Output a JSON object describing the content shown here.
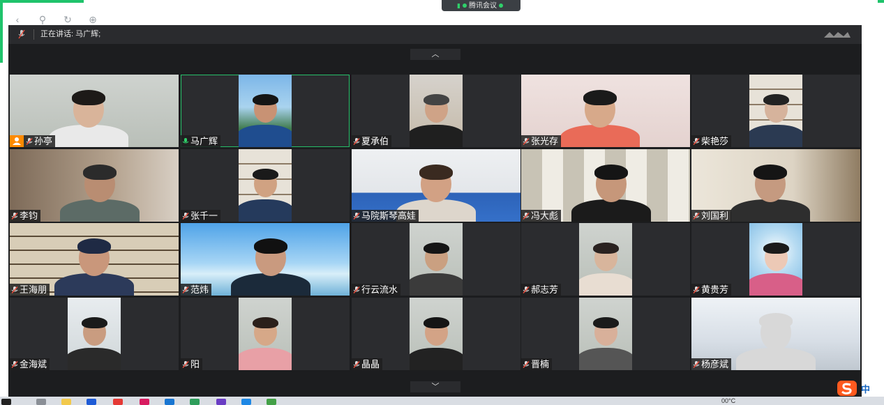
{
  "meeting_pill": {
    "label": "腾讯会议"
  },
  "title_bar": {
    "speaking_label": "正在讲话: 马广辉;"
  },
  "pager": {
    "up": "︿",
    "down": "﹀"
  },
  "participants": [
    {
      "name": "孙亭",
      "host": true,
      "active": false,
      "scene": "wall-light",
      "skin": "#d9b49a",
      "hair": "#1d1a18",
      "shirt": "#e9e9e9"
    },
    {
      "name": "马广辉",
      "host": false,
      "active": true,
      "scene": "mountain",
      "skin": "#c89274",
      "hair": "#151515",
      "shirt": "#1f4d8f"
    },
    {
      "name": "夏承伯",
      "host": false,
      "active": false,
      "scene": "office",
      "skin": "#cfa387",
      "hair": "#444",
      "shirt": "#1f1f1f"
    },
    {
      "name": "张光存",
      "host": false,
      "active": false,
      "scene": "pink-wall",
      "skin": "#d7a98a",
      "hair": "#1a1a1a",
      "shirt": "#e96b58"
    },
    {
      "name": "柴艳莎",
      "host": false,
      "active": false,
      "scene": "shelf",
      "skin": "#d6b39c",
      "hair": "#222",
      "shirt": "#2b3a52"
    },
    {
      "name": "李钧",
      "host": false,
      "active": false,
      "scene": "room-brown",
      "skin": "#b98d72",
      "hair": "#2b2b2b",
      "shirt": "#5c6b66"
    },
    {
      "name": "张千一",
      "host": false,
      "active": false,
      "scene": "shelf",
      "skin": "#d0a282",
      "hair": "#1a1a1a",
      "shirt": "#253a5c"
    },
    {
      "name": "马院斯琴高娃",
      "host": false,
      "active": false,
      "scene": "blue-room",
      "skin": "#d2a184",
      "hair": "#3a2a20",
      "shirt": "#ddd6cc"
    },
    {
      "name": "冯大彪",
      "host": false,
      "active": false,
      "scene": "bookcase",
      "skin": "#c6977a",
      "hair": "#151515",
      "shirt": "#1b1b1b"
    },
    {
      "name": "刘国利",
      "host": false,
      "active": false,
      "scene": "cabinet",
      "skin": "#c59a80",
      "hair": "#151515",
      "shirt": "#2e2e2e"
    },
    {
      "name": "王海朋",
      "host": false,
      "active": false,
      "scene": "bookshelf",
      "skin": "#c9977b",
      "hair": "#1f2a44",
      "shirt": "#2c3a5a"
    },
    {
      "name": "范炜",
      "host": false,
      "active": false,
      "scene": "sky",
      "skin": "#c99a7f",
      "hair": "#111",
      "shirt": "#1b2a3a"
    },
    {
      "name": "行云流水",
      "host": false,
      "active": false,
      "scene": "wall-light",
      "skin": "#caa081",
      "hair": "#151515",
      "shirt": "#3b3b3b"
    },
    {
      "name": "郝志芳",
      "host": false,
      "active": false,
      "scene": "wall-light",
      "skin": "#d8b59c",
      "hair": "#2a2220",
      "shirt": "#e8ddd2"
    },
    {
      "name": "黄贵芳",
      "host": false,
      "active": false,
      "scene": "swirl",
      "skin": "#ecc9b6",
      "hair": "#1b1b1b",
      "shirt": "#d85f88"
    },
    {
      "name": "金海斌",
      "host": false,
      "active": false,
      "scene": "tree",
      "skin": "#c99c80",
      "hair": "#1a1a1a",
      "shirt": "#2a2a2a"
    },
    {
      "name": "阳",
      "host": false,
      "active": false,
      "scene": "wall-light",
      "skin": "#d6a888",
      "hair": "#2a1f1a",
      "shirt": "#e8a0a6"
    },
    {
      "name": "晶晶",
      "host": false,
      "active": false,
      "scene": "wall-light",
      "skin": "#d3a386",
      "hair": "#151515",
      "shirt": "#222"
    },
    {
      "name": "晋楠",
      "host": false,
      "active": false,
      "scene": "wall-light",
      "skin": "#d8b09a",
      "hair": "#1b1b1b",
      "shirt": "#555"
    },
    {
      "name": "杨彦斌",
      "host": false,
      "active": false,
      "scene": "white-room",
      "skin": "#d8d8d8",
      "hair": "#d8d8d8",
      "shirt": "#d8d8d8"
    }
  ],
  "taskbar": {
    "weather": "00°C",
    "ime_label": "中"
  },
  "colors": {
    "accent": "#26c06a",
    "window_bg": "#1c1d1f",
    "tile_bg": "#2b2c2f",
    "host_badge": "#ff8a00"
  }
}
